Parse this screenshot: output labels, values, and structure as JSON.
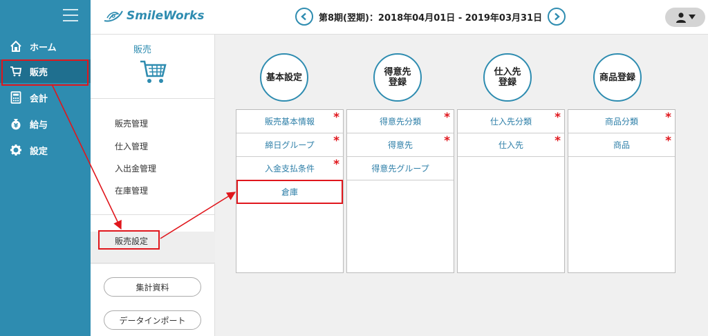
{
  "app": {
    "logo_text": "SmileWorks"
  },
  "header": {
    "period": "第8期(翌期)：2018年04月01日 - 2019年03月31日"
  },
  "nav": [
    {
      "label": "ホーム",
      "icon": "home-icon"
    },
    {
      "label": "販売",
      "icon": "cart-icon"
    },
    {
      "label": "会計",
      "icon": "calculator-icon"
    },
    {
      "label": "給与",
      "icon": "money-bag-icon"
    },
    {
      "label": "設定",
      "icon": "gear-icon"
    }
  ],
  "subpanel": {
    "title": "販売",
    "links": [
      "販売管理",
      "仕入管理",
      "入出金管理",
      "在庫管理"
    ],
    "active_label": "販売設定",
    "buttons": [
      "集計資料",
      "データインポート"
    ]
  },
  "sections": [
    {
      "title": "基本設定",
      "items": [
        {
          "label": "販売基本情報",
          "required": true
        },
        {
          "label": "締日グループ",
          "required": true
        },
        {
          "label": "入金支払条件",
          "required": true
        },
        {
          "label": "倉庫",
          "required": false
        }
      ]
    },
    {
      "title": "得意先\n登録",
      "items": [
        {
          "label": "得意先分類",
          "required": true
        },
        {
          "label": "得意先",
          "required": true
        },
        {
          "label": "得意先グループ",
          "required": false
        }
      ]
    },
    {
      "title": "仕入先\n登録",
      "items": [
        {
          "label": "仕入先分類",
          "required": true
        },
        {
          "label": "仕入先",
          "required": true
        }
      ]
    },
    {
      "title": "商品登録",
      "items": [
        {
          "label": "商品分類",
          "required": true
        },
        {
          "label": "商品",
          "required": true
        }
      ]
    }
  ],
  "required_mark": "*",
  "colors": {
    "nav_bg": "#2e8cb0",
    "accent": "#2e8cb0",
    "highlight": "#e0161c",
    "required": "#e0161c"
  }
}
